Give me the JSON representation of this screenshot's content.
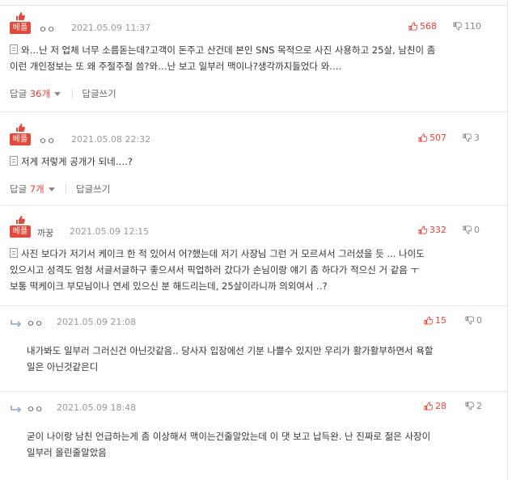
{
  "badge_label": "베플",
  "comments": [
    {
      "nick": "ㅇㅇ",
      "date": "2021.05.09 11:37",
      "likes": "568",
      "dislikes": "110",
      "lines": [
        "와…난 저 업체 너무 소름돋는데?고객이 돈주고 산건데 본인 SNS 목적으로 사진 사용하고 25살, 남친이 좀",
        "이런 개인정보는 또 왜 주절주절 씀?와…난 보고 일부러 맥이나?생각까지들었다 와…."
      ],
      "reply_label": "답글",
      "reply_count": "36개",
      "write_label": "답글쓰기"
    },
    {
      "nick": "ㅇㅇ",
      "date": "2021.05.08 22:32",
      "likes": "507",
      "dislikes": "3",
      "lines": [
        "저게 저렇게 공개가 되네….?"
      ],
      "reply_label": "답글",
      "reply_count": "7개",
      "write_label": "답글쓰기"
    },
    {
      "nick": "까꿍",
      "date": "2021.05.09 12:15",
      "likes": "332",
      "dislikes": "0",
      "lines": [
        "사진 보다가 저기서 케이크 한 적 있어서 어?했는데 저기 사장님 그런 거 모르셔서 그러셨을 듯 ... 나이도",
        "있으시고 성격도 엄청 서글서글하구 좋으셔서 픽업하러 갔다가 손님이랑 얘기 좀 하다가 적으신 거 같음 ㅜ",
        "보통 떡케이크 부모님이나 연세 있으신 분 해드리는데, 25살이라니까 의외여서 ..?"
      ]
    }
  ],
  "replies": [
    {
      "nick": "ㅇㅇ",
      "date": "2021.05.09 21:08",
      "likes": "15",
      "dislikes": "0",
      "lines": [
        "내가봐도 일부러 그러신건 아닌갓같음.. 당사자 입장에선 기분 나쁠수 있지만 우리가 활가활부하면서 욕할",
        "일은 아닌것같은디"
      ]
    },
    {
      "nick": "ㅇㅇ",
      "date": "2021.05.09 18:48",
      "likes": "28",
      "dislikes": "2",
      "lines": [
        "굳이 나이랑 남친 언급하는게 좀 이상해서 맥이는건줄알았는데 이 댓 보고 납득완. 난 진짜로 젊은 사장이",
        "일부러 올린줄알았음"
      ]
    }
  ],
  "colors": {
    "accent": "#e04a3c",
    "like": "#e0443a",
    "muted": "#999999"
  },
  "icons": {
    "like": "thumb-up-icon",
    "dislike": "thumb-down-icon",
    "reply_arrow": "reply-arrow-icon",
    "doc": "document-icon"
  }
}
